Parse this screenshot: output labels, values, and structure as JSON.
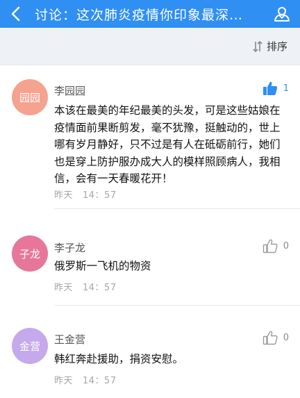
{
  "header": {
    "title": "讨论：这次肺炎疫情你印象最深…",
    "back_icon": "chevron-left-icon",
    "user_icon": "user-icon",
    "bg_color": "#2f8ff3"
  },
  "sortbar": {
    "sort_label": "排序",
    "sort_icon": "sort-icon"
  },
  "comments": [
    {
      "avatar_text": "园园",
      "avatar_color": "#f5a28f",
      "author": "李园园",
      "likes": "1",
      "liked": true,
      "content": "本该在最美的年纪最美的头发，可是这些姑娘在疫情面前果断剪发，毫不犹豫，挺触动的，世上哪有岁月静好，只不过是有人在砥砺前行，她们也是穿上防护服办成大人的模样照顾病人，我相信，会有一天春暖花开！",
      "date": "昨天",
      "time": "14：57"
    },
    {
      "avatar_text": "子龙",
      "avatar_color": "#e7779a",
      "author": "李子龙",
      "likes": "0",
      "liked": false,
      "content": "俄罗斯一飞机的物资",
      "date": "昨天",
      "time": "14：57"
    },
    {
      "avatar_text": "金营",
      "avatar_color": "#c4a9ec",
      "author": "王金营",
      "likes": "0",
      "liked": false,
      "content": "韩红奔赴援助，捐资安慰。",
      "date": "昨天",
      "time": "14：57"
    }
  ]
}
